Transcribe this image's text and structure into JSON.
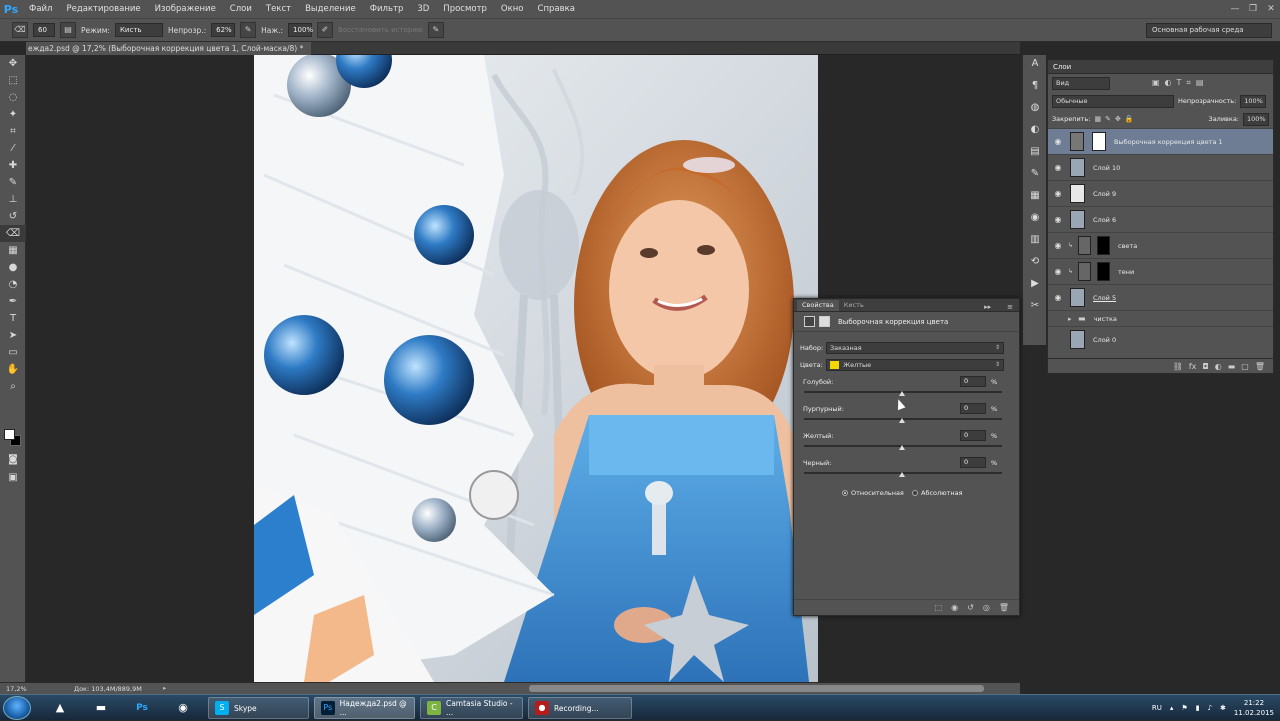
{
  "app": {
    "logo": "Ps"
  },
  "menu": [
    "Файл",
    "Редактирование",
    "Изображение",
    "Слои",
    "Текст",
    "Выделение",
    "Фильтр",
    "3D",
    "Просмотр",
    "Окно",
    "Справка"
  ],
  "window_controls": [
    "—",
    "❐",
    "✕"
  ],
  "options_bar": {
    "brush_size": "60",
    "mode_label": "Режим:",
    "mode_value": "Кисть",
    "opacity_label": "Непрозр.:",
    "opacity_value": "62%",
    "flow_label": "Наж.:",
    "flow_value": "100%",
    "erase_history": "Восстановить историю",
    "workspace": "Основная рабочая среда"
  },
  "document_tab": "ежда2.psd @ 17,2% (Выборочная коррекция цвета 1, Слой-маска/8) *",
  "status": {
    "zoom": "17,2%",
    "doc_size": "Док: 103,4M/889,9M"
  },
  "layers_panel": {
    "tab": "Слои",
    "filter": "Вид",
    "blend_mode": "Обычные",
    "opacity_label": "Непрозрачность:",
    "opacity_value": "100%",
    "lock_label": "Закрепить:",
    "fill_label": "Заливка:",
    "fill_value": "100%",
    "layers": [
      {
        "name": "Выборочная коррекция цвета 1",
        "selected": true,
        "visible": true
      },
      {
        "name": "Слой 10",
        "visible": true
      },
      {
        "name": "Слой 9",
        "visible": true
      },
      {
        "name": "Слой 6",
        "visible": true
      },
      {
        "name": "света",
        "visible": true
      },
      {
        "name": "тени",
        "visible": true
      },
      {
        "name": "Слой 5",
        "visible": true
      },
      {
        "name": "чистка",
        "visible": false
      },
      {
        "name": "Слой 0",
        "visible": false
      }
    ]
  },
  "properties_panel": {
    "tabs": [
      "Свойства",
      "Кисть"
    ],
    "title": "Выборочная коррекция цвета",
    "preset_label": "Набор:",
    "preset_value": "Заказная",
    "colors_label": "Цвета:",
    "colors_value": "Желтые",
    "colors_swatch": "#f5d800",
    "sliders": [
      {
        "label": "Голубой:",
        "value": "0",
        "unit": "%"
      },
      {
        "label": "Пурпурный:",
        "value": "0",
        "unit": "%"
      },
      {
        "label": "Желтый:",
        "value": "0",
        "unit": "%"
      },
      {
        "label": "Черный:",
        "value": "0",
        "unit": "%"
      }
    ],
    "method_relative": "Относительная",
    "method_absolute": "Абсолютная"
  },
  "taskbar": {
    "apps": [
      {
        "label": "Skype"
      },
      {
        "label": "Надежда2.psd @ ..."
      },
      {
        "label": "Camtasia Studio - ..."
      },
      {
        "label": "Recording..."
      }
    ],
    "lang": "RU",
    "time": "21:22",
    "date": "11.02.2015"
  }
}
